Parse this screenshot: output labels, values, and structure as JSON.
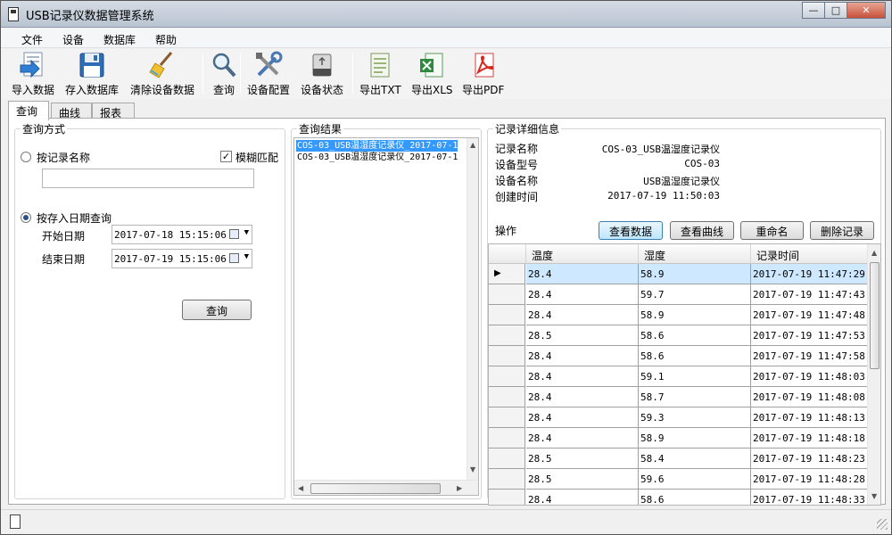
{
  "window": {
    "title": "USB记录仪数据管理系统"
  },
  "menu": [
    "文件",
    "设备",
    "数据库",
    "帮助"
  ],
  "toolbar": {
    "import_data": "导入数据",
    "save_db": "存入数据库",
    "clear_device": "清除设备数据",
    "query": "查询",
    "device_config": "设备配置",
    "device_status": "设备状态",
    "export_txt": "导出TXT",
    "export_xls": "导出XLS",
    "export_pdf": "导出PDF"
  },
  "tabs": [
    "查询",
    "曲线",
    "报表"
  ],
  "query_panel": {
    "legend": "查询方式",
    "by_name_label": "按记录名称",
    "by_name_value": "",
    "fuzzy_label": "模糊匹配",
    "fuzzy_checked": true,
    "by_date_label": "按存入日期查询",
    "by_date_selected": true,
    "start_label": "开始日期",
    "start_value": "2017-07-18 15:15:06",
    "end_label": "结束日期",
    "end_value": "2017-07-19 15:15:06",
    "query_button": "查询"
  },
  "results": {
    "legend": "查询结果",
    "items": [
      "COS-03_USB温湿度记录仪_2017-07-1",
      "COS-03_USB温湿度记录仪_2017-07-1"
    ],
    "selected_index": 0
  },
  "details": {
    "legend": "记录详细信息",
    "fields": [
      {
        "label": "记录名称",
        "value": "COS-03_USB温湿度记录仪"
      },
      {
        "label": "设备型号",
        "value": "COS-03"
      },
      {
        "label": "设备名称",
        "value": "USB温湿度记录仪"
      },
      {
        "label": "创建时间",
        "value": "2017-07-19 11:50:03"
      }
    ],
    "ops_label": "操作",
    "buttons": {
      "view_data": "查看数据",
      "view_curve": "查看曲线",
      "rename": "重命名",
      "delete": "删除记录"
    }
  },
  "table": {
    "columns": [
      "温度",
      "湿度",
      "记录时间"
    ],
    "rows": [
      [
        "28.4",
        "58.9",
        "2017-07-19 11:47:29"
      ],
      [
        "28.4",
        "59.7",
        "2017-07-19 11:47:43"
      ],
      [
        "28.4",
        "58.9",
        "2017-07-19 11:47:48"
      ],
      [
        "28.5",
        "58.6",
        "2017-07-19 11:47:53"
      ],
      [
        "28.4",
        "58.6",
        "2017-07-19 11:47:58"
      ],
      [
        "28.4",
        "59.1",
        "2017-07-19 11:48:03"
      ],
      [
        "28.4",
        "58.7",
        "2017-07-19 11:48:08"
      ],
      [
        "28.4",
        "59.3",
        "2017-07-19 11:48:13"
      ],
      [
        "28.4",
        "58.9",
        "2017-07-19 11:48:18"
      ],
      [
        "28.5",
        "58.4",
        "2017-07-19 11:48:23"
      ],
      [
        "28.5",
        "59.6",
        "2017-07-19 11:48:28"
      ],
      [
        "28.4",
        "58.6",
        "2017-07-19 11:48:33"
      ]
    ],
    "selected_row": 0
  },
  "colors": {
    "selection": "#3399ff",
    "grid_selection": "#cde8ff",
    "pdf_red": "#d9261c",
    "xls_green": "#2e8b3d"
  }
}
